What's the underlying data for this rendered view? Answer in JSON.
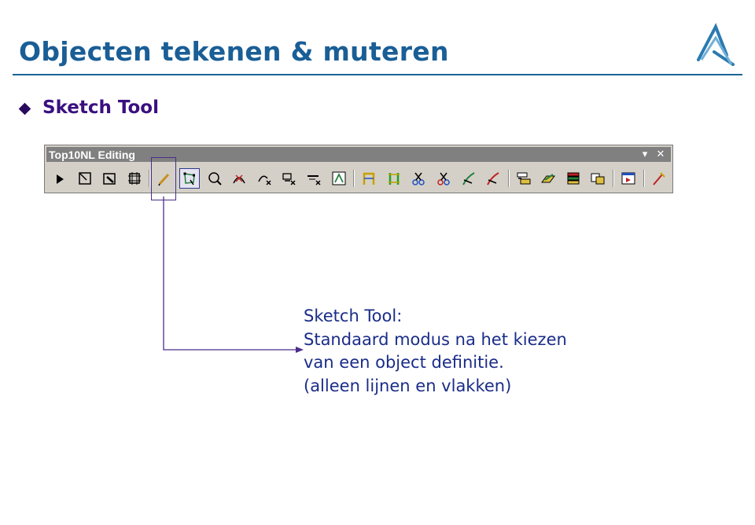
{
  "slide": {
    "title": "Objecten tekenen & muteren",
    "bullet_text": "Sketch Tool"
  },
  "toolbar": {
    "title": "Top10NL Editing",
    "controls": {
      "dropdown": "▾",
      "close": "✕"
    },
    "icons": [
      {
        "name": "select-arrow-icon",
        "interactable": true
      },
      {
        "name": "edit-vertices-icon",
        "interactable": true
      },
      {
        "name": "reshape-icon",
        "interactable": true
      },
      {
        "name": "modify-feature-icon",
        "interactable": true
      },
      {
        "name": "separator"
      },
      {
        "name": "sketch-tool-icon",
        "interactable": true
      },
      {
        "name": "edit-polygon-icon",
        "interactable": true,
        "active": true
      },
      {
        "name": "zoom-circle-icon",
        "interactable": true
      },
      {
        "name": "intersect-icon",
        "interactable": true
      },
      {
        "name": "arc-delete-icon",
        "interactable": true
      },
      {
        "name": "split-delete-icon",
        "interactable": true
      },
      {
        "name": "line-delete-icon",
        "interactable": true
      },
      {
        "name": "triangle-shape-icon",
        "interactable": true
      },
      {
        "name": "separator"
      },
      {
        "name": "snap-yellow-icon",
        "interactable": true
      },
      {
        "name": "snap-green-icon",
        "interactable": true
      },
      {
        "name": "scissors-blue-icon",
        "interactable": true
      },
      {
        "name": "scissors-red-icon",
        "interactable": true
      },
      {
        "name": "pen-green-icon",
        "interactable": true
      },
      {
        "name": "pen-red-icon",
        "interactable": true
      },
      {
        "name": "separator"
      },
      {
        "name": "layer-add-icon",
        "interactable": true
      },
      {
        "name": "layer-move-icon",
        "interactable": true
      },
      {
        "name": "stack-icon",
        "interactable": true
      },
      {
        "name": "copy-shape-icon",
        "interactable": true
      },
      {
        "name": "separator"
      },
      {
        "name": "properties-window-icon",
        "interactable": true
      },
      {
        "name": "separator"
      },
      {
        "name": "wand-icon",
        "interactable": true
      }
    ]
  },
  "callout": {
    "lines": [
      "Sketch Tool:",
      "Standaard modus na het kiezen",
      "van een object definitie.",
      "(alleen lijnen en vlakken)"
    ]
  },
  "colors": {
    "title": "#1a5e96",
    "subtitle": "#3a1080",
    "callout_text": "#1a2c88",
    "callout_line": "#4b2c8c",
    "toolbar_bg": "#d4d0c8",
    "titlebar_bg": "#808080"
  }
}
